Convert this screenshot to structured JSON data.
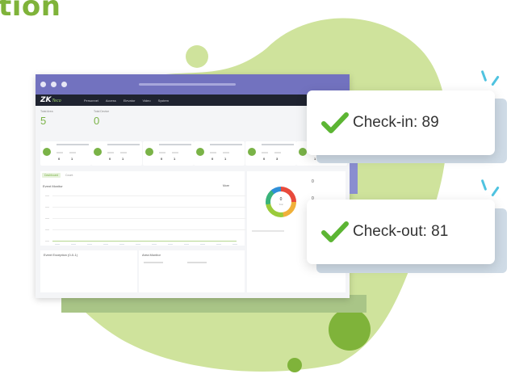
{
  "heading": "tion",
  "app": {
    "brand": "ZKTeco",
    "brand_main": "ZK",
    "brand_sub": "Teco",
    "nav": [
      "Personnel",
      "Access",
      "Elevator",
      "Video",
      "System"
    ]
  },
  "dashboard": {
    "stat1": {
      "label": "Total Area",
      "value": "5"
    },
    "stat2": {
      "label": "Total Device",
      "value": "0"
    },
    "tabs": [
      "Dashboard",
      "Count"
    ],
    "chart_title": "Event Monitor",
    "chart_button": "More",
    "table_title": "Event Exception (0-0-1)",
    "alarm_title": "Area Monitor",
    "donut_value": "0",
    "side_values": [
      "0",
      "0"
    ]
  },
  "popups": {
    "checkin_label": "Check-in: 89",
    "checkout_label": "Check-out: 81"
  },
  "colors": {
    "brand_green": "#7fb33a",
    "blob_green": "#cfe39c",
    "titlebar": "#7272bf",
    "check": "#5cb533"
  }
}
